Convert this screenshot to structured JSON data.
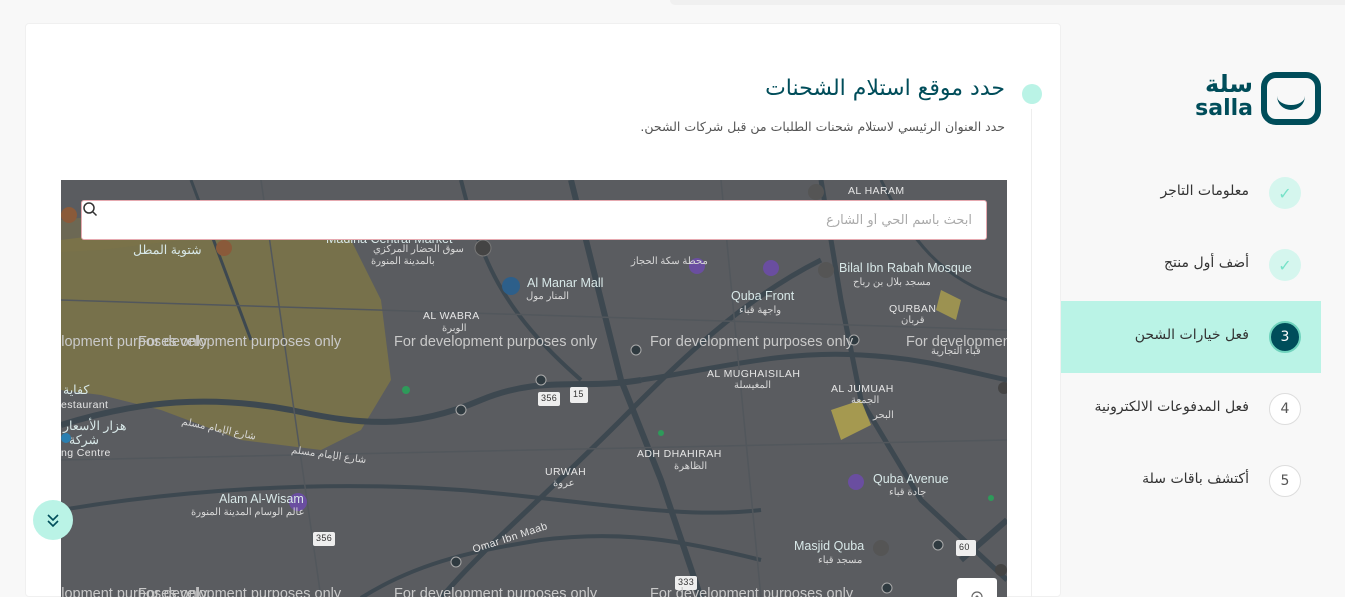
{
  "brand": {
    "name_ar": "سلة",
    "name_en": "salla"
  },
  "steps": [
    {
      "label": "معلومات التاجر",
      "number": "✓",
      "state": "done"
    },
    {
      "label": "أضف أول منتج",
      "number": "✓",
      "state": "done"
    },
    {
      "label": "فعل خيارات الشحن",
      "number": "3",
      "state": "active"
    },
    {
      "label": "فعل المدفوعات الالكترونية",
      "number": "4",
      "state": "todo"
    },
    {
      "label": "أكتشف باقات سلة",
      "number": "5",
      "state": "todo"
    }
  ],
  "main": {
    "title": "حدد موقع استلام الشحنات",
    "subtitle": "حدد العنوان الرئيسي لاستلام شحنات الطلبات من قبل شركات الشحن."
  },
  "search": {
    "placeholder": "ابحث باسم الحي أو الشارع",
    "value": ""
  },
  "map": {
    "dev_notice": "For development purposes only",
    "labels": {
      "al_haram": "AL HARAM",
      "bilal_en": "Bilal Ibn Rabah Mosque",
      "bilal_ar": "مسجد بلال بن رباح",
      "al_manar_en": "Al Manar Mall",
      "al_manar_ar": "المنار مول",
      "madina_central": "Madina Central Market",
      "madina_central_ar": "سوق الحضار المركزي",
      "madina_central_ar2": "بالمدينة المنورة",
      "shatwiyat": "شتوية المطل",
      "quba_front_en": "Quba Front",
      "quba_front_ar": "واجهة قباء",
      "quran": "QURBAN",
      "quran_ar": "قربان",
      "al_wabra": "AL WABRA",
      "al_wabra_ar": "الوبرة",
      "al_mughaisilah": "AL MUGHAISILAH",
      "al_mughaisilah_ar": "المغيسلة",
      "al_jumuah": "AL JUMUAH",
      "al_jumuah_ar": "الجمعة",
      "al_bahr": "البحر",
      "adh_dhahirah": "ADH DHAHIRAH",
      "adh_dhahirah_ar": "الظاهرة",
      "urwah": "URWAH",
      "urwah_ar": "عروة",
      "quba_avenue_en": "Quba Avenue",
      "quba_avenue_ar": "جادة قباء",
      "alam_en": "Alam Al-Wisam",
      "alam_ar": "عالم الوسام المدينة المنورة",
      "omar": "Omar Ibn Maab",
      "masjid_quba_en": "Masjid Quba",
      "masjid_quba_ar": "مسجد قباء",
      "imam_muslim_1": "شارع الإمام مسلم",
      "imam_muslim_2": "شارع الإمام مسلم",
      "kifaya": "كفاية",
      "restaurant": "estaurant",
      "hazar": "هزار الأسعار",
      "sharika": "شركة",
      "ng_centre": "ng Centre",
      "mahatta": "محطة سكة الحجاز",
      "quba_trade": "قباء التجارية",
      "road_356a": "356",
      "road_15": "15",
      "road_356b": "356",
      "road_333": "333",
      "road_60": "60"
    }
  },
  "colors": {
    "brand_dark": "#004d5a",
    "brand_light": "#baf3e6",
    "map_base": "#5a5c60",
    "map_park": "#8a7c45",
    "map_road": "#3e4a52"
  },
  "icons": {
    "search": "search-icon",
    "check": "check-icon",
    "scroll": "chevron-double-down-icon",
    "location": "location-pin-icon"
  }
}
